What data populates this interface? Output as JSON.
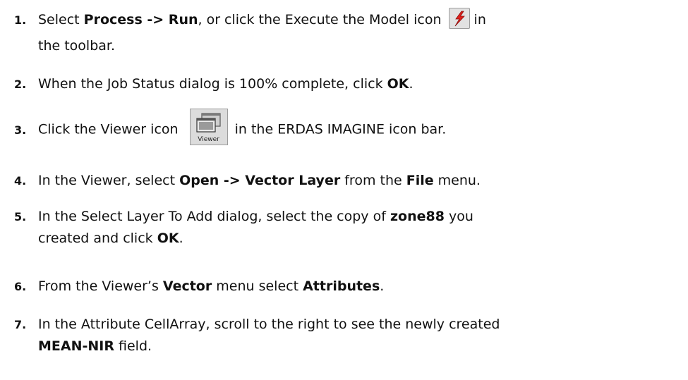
{
  "steps": [
    {
      "num": "1.",
      "a": "Select ",
      "b1": "Process -> Run",
      "c": ", or click the Execute the Model icon",
      "d": "in",
      "line2": "the toolbar."
    },
    {
      "num": "2.",
      "a": "When the Job Status dialog is 100% complete, click ",
      "b1": "OK",
      "c": "."
    },
    {
      "num": "3.",
      "a": "Click the Viewer icon",
      "icon_label": "Viewer",
      "c": "in the ERDAS IMAGINE icon bar."
    },
    {
      "num": "4.",
      "a": "In the Viewer, select ",
      "b1": "Open -> Vector Layer",
      "c": " from the ",
      "b2": "File",
      "d": " menu."
    },
    {
      "num": "5.",
      "a": "In the Select Layer To Add dialog, select the copy of ",
      "b1": "zone88",
      "c": " you",
      "line2a": "created and click ",
      "line2b": "OK",
      "line2c": "."
    },
    {
      "num": "6.",
      "a": "From the Viewer’s ",
      "b1": "Vector",
      "c": " menu select ",
      "b2": "Attributes",
      "d": "."
    },
    {
      "num": "7.",
      "a": "In the Attribute CellArray, scroll to the right to see the newly created",
      "line2b": "MEAN-NIR",
      "line2c": " field."
    }
  ],
  "icons": {
    "execute": "execute-model-icon",
    "viewer": "viewer-icon",
    "accent": "#e0201c"
  }
}
